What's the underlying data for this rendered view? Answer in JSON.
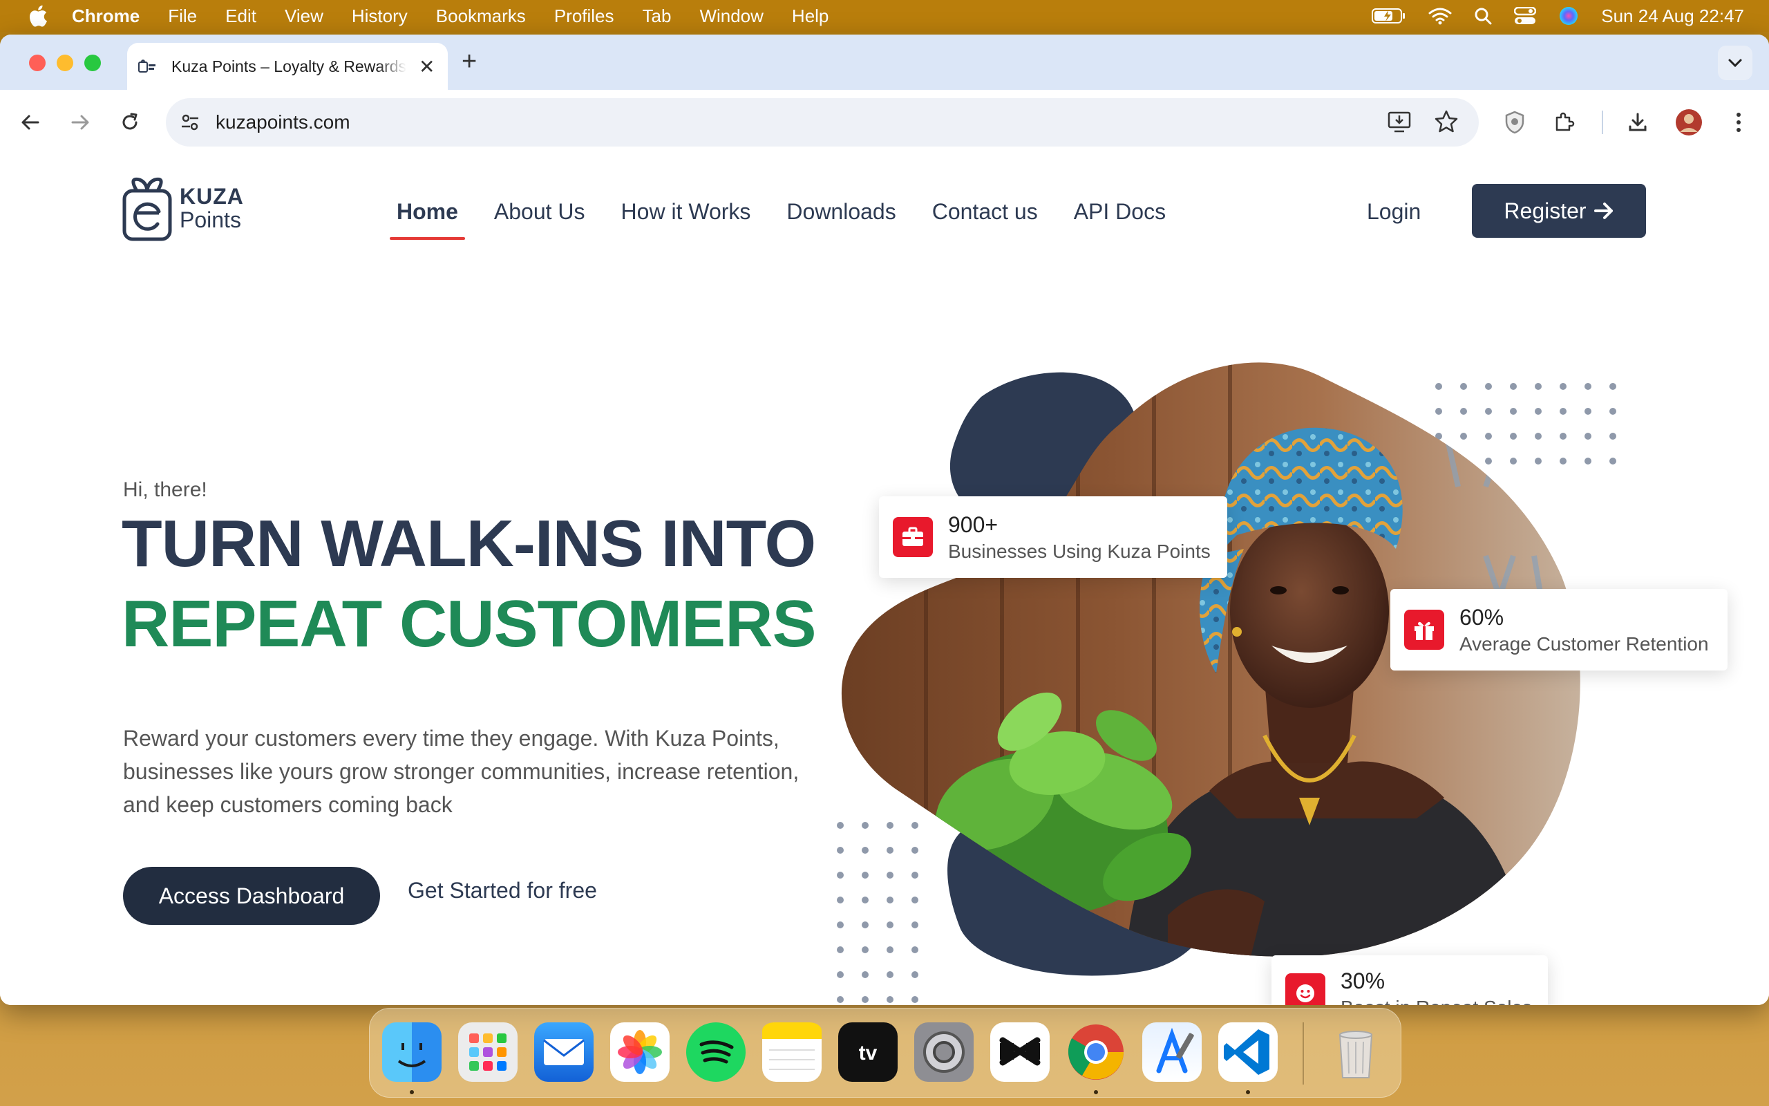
{
  "menubar": {
    "app_name": "Chrome",
    "items": [
      "File",
      "Edit",
      "View",
      "History",
      "Bookmarks",
      "Profiles",
      "Tab",
      "Window",
      "Help"
    ],
    "datetime": "Sun 24 Aug  22:47"
  },
  "browser": {
    "tab_title": "Kuza Points – Loyalty & Rewards",
    "url": "kuzapoints.com"
  },
  "site": {
    "logo": {
      "line1": "KUZA",
      "line2": "Points"
    },
    "nav": [
      "Home",
      "About Us",
      "How it Works",
      "Downloads",
      "Contact us",
      "API Docs"
    ],
    "active_nav": "Home",
    "login_label": "Login",
    "register_label": "Register",
    "greeting": "Hi, there!",
    "headline_line1": "TURN WALK-INS INTO",
    "headline_line2": "REPEAT CUSTOMERS",
    "description": "Reward your customers every time they engage. With Kuza Points, businesses like yours grow stronger communities, increase retention, and keep customers coming back",
    "cta_primary": "Access Dashboard",
    "cta_secondary": "Get Started for free",
    "stats": [
      {
        "value": "900+",
        "label": "Businesses Using Kuza Points",
        "icon": "briefcase-icon"
      },
      {
        "value": "60%",
        "label": "Average Customer Retention",
        "icon": "gift-icon"
      },
      {
        "value": "30%",
        "label": "Boost in Repeat Sales",
        "icon": "smile-icon"
      }
    ]
  },
  "dock": {
    "apps": [
      "Finder",
      "Launchpad",
      "Mail",
      "Photos",
      "Spotify",
      "Notes",
      "TV",
      "System Settings",
      "CapCut",
      "Chrome",
      "Xcode",
      "VS Code",
      "Trash"
    ]
  },
  "colors": {
    "brand_navy": "#2d3a52",
    "brand_green": "#1f8a57",
    "accent_red": "#e8192c"
  }
}
